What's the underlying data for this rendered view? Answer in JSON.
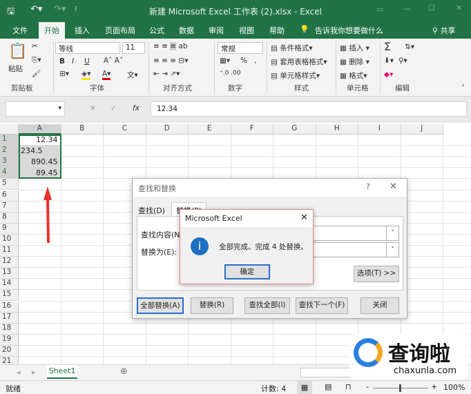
{
  "window": {
    "title": "新建 Microsoft Excel 工作表 (2).xlsx  -  Excel"
  },
  "tabs": [
    "文件",
    "开始",
    "插入",
    "页面布局",
    "公式",
    "数据",
    "审阅",
    "视图",
    "帮助"
  ],
  "tell_me": "告诉我你想要做什么",
  "share": "共享",
  "ribbon": {
    "clipboard": {
      "paste": "粘贴",
      "label": "剪贴板"
    },
    "font": {
      "name": "等线",
      "size": "11",
      "bold": "B",
      "italic": "I",
      "underline": "U",
      "label": "字体"
    },
    "alignment": {
      "label": "对齐方式"
    },
    "number": {
      "format": "常规",
      "percent": "%",
      "comma": ",",
      "label": "数字"
    },
    "styles": {
      "conditional": "条件格式",
      "table": "套用表格格式",
      "cell": "单元格样式",
      "label": "样式"
    },
    "cells": {
      "insert": "插入",
      "delete": "删除",
      "format": "格式",
      "label": "单元格"
    },
    "editing": {
      "sum": "Σ",
      "label": "编辑"
    }
  },
  "formula_bar": {
    "fx": "fx",
    "value": "12.34"
  },
  "columns": [
    "A",
    "B",
    "C",
    "D",
    "E",
    "F",
    "G",
    "H",
    "I",
    "J"
  ],
  "rows": [
    "1",
    "2",
    "3",
    "4",
    "5",
    "6",
    "7",
    "8",
    "9",
    "10",
    "11",
    "12",
    "13",
    "14",
    "15",
    "16",
    "17",
    "18",
    "19",
    "20",
    "21"
  ],
  "cells": [
    {
      "row": 1,
      "value": "12.34",
      "align": "right"
    },
    {
      "row": 2,
      "value": "234.5",
      "align": "left"
    },
    {
      "row": 3,
      "value": "890.45",
      "align": "right"
    },
    {
      "row": 4,
      "value": "89.45",
      "align": "right"
    }
  ],
  "find_dialog": {
    "title": "查找和替换",
    "help": "?",
    "tab_find": "查找(D)",
    "tab_replace": "替换(P)",
    "find_label": "查找内容(N):",
    "replace_label": "替换为(E):",
    "options": "选项(T) >>",
    "buttons": [
      "全部替换(A)",
      "替换(R)",
      "查找全部(I)",
      "查找下一个(F)",
      "关闭"
    ]
  },
  "message_box": {
    "title": "Microsoft Excel",
    "message": "全部完成。完成 4 处替换。",
    "ok": "确定"
  },
  "sheet": {
    "tab": "Sheet1"
  },
  "status": {
    "ready": "就绪",
    "count": "计数: 4",
    "zoom": "100%"
  },
  "watermark": {
    "name": "查询啦",
    "url": "chaxunla.com"
  },
  "colors": {
    "excel_green": "#217346",
    "arrow": "#e8332f",
    "selection": "#217346"
  }
}
